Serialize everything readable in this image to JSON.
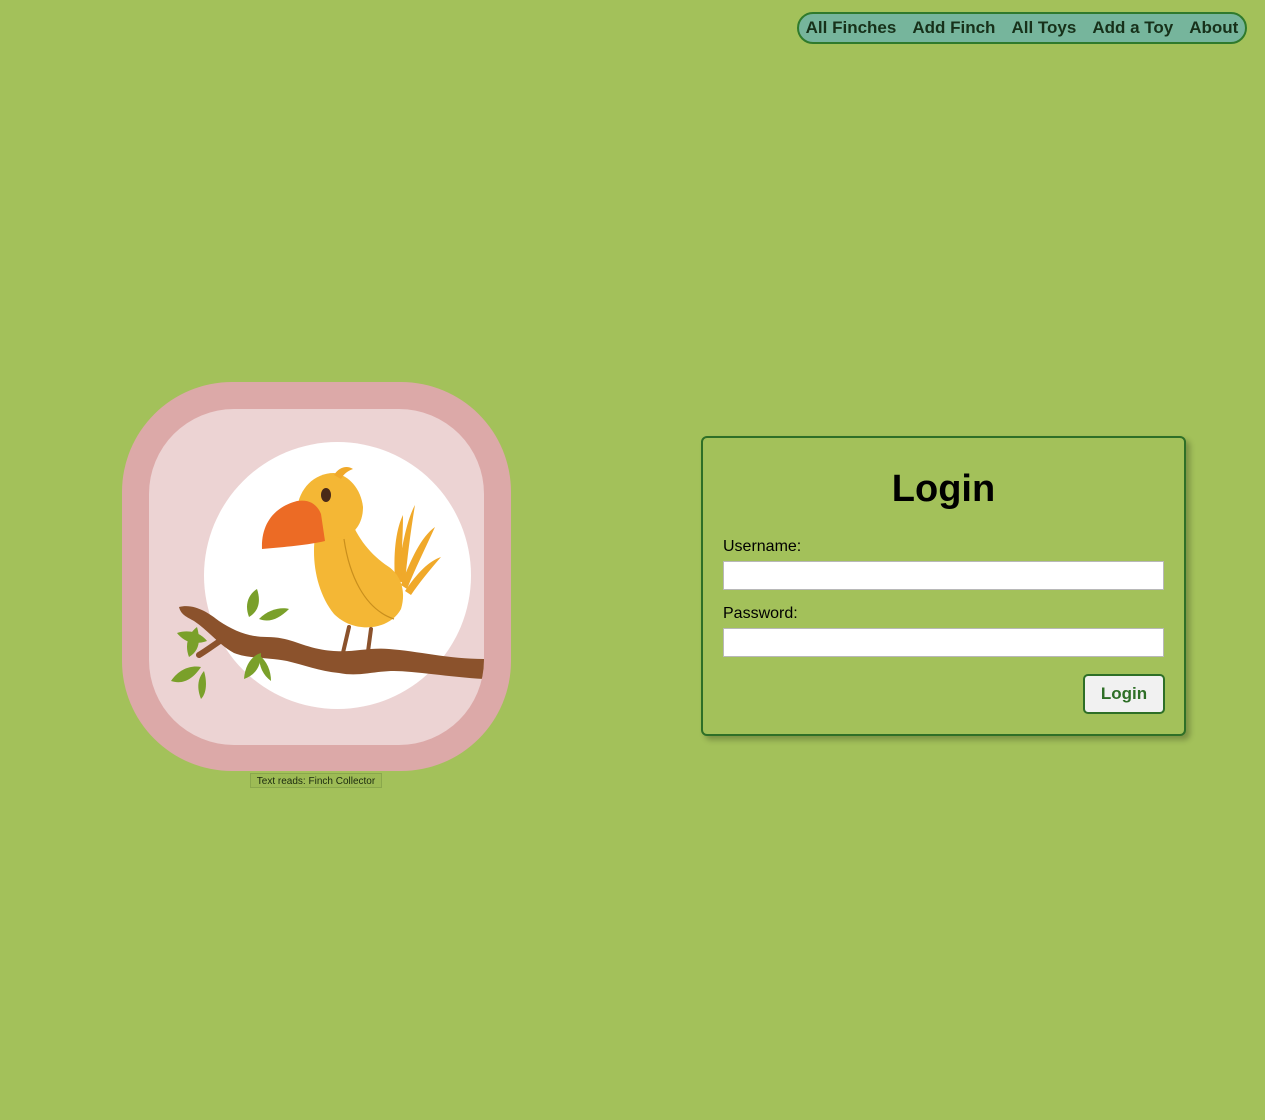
{
  "nav": {
    "items": [
      {
        "label": "All Finches"
      },
      {
        "label": "Add Finch"
      },
      {
        "label": "All Toys"
      },
      {
        "label": "Add a Toy"
      },
      {
        "label": "About"
      }
    ]
  },
  "logo": {
    "caption": "Text reads: Finch Collector"
  },
  "login": {
    "title": "Login",
    "username_label": "Username:",
    "username_value": "",
    "password_label": "Password:",
    "password_value": "",
    "button_label": "Login"
  },
  "colors": {
    "background": "#a3c15a",
    "nav_background": "#76b59c",
    "accent_green": "#2e6f27",
    "logo_outer": "#dca9a8",
    "logo_inner": "#ecd3d3",
    "bird_yellow": "#f4b735",
    "beak_orange": "#ec6b25",
    "branch_brown": "#8b522c",
    "leaf_green": "#7aa02a"
  }
}
